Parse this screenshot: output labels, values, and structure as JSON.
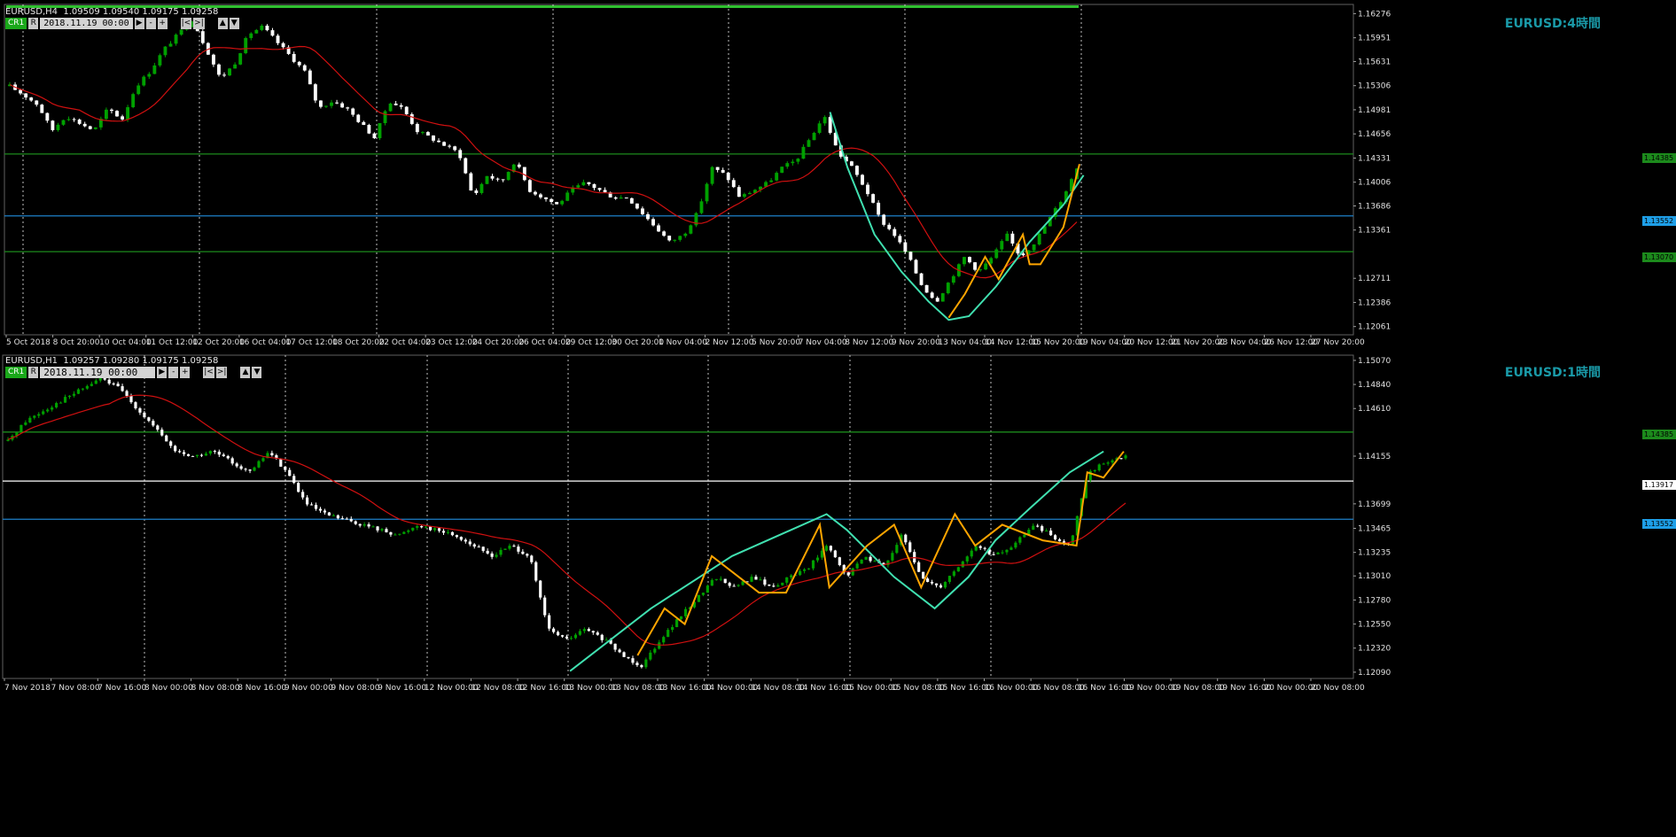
{
  "theme": {
    "bull_color": "#00a000",
    "bear_color": "#ffffff",
    "ma_color": "#d01010",
    "grid_color": "#808080",
    "hline_blue": "#1e7fc8",
    "hline_green": "#1c8a1c",
    "hline_white": "#ffffff",
    "wave_teal": "#40e0b0",
    "wave_orange": "#ffa500",
    "label_color": "#1a9aa8"
  },
  "top_chart": {
    "header": "EURUSD,H4  1.09509 1.09540 1.09175 1.09258",
    "controls": {
      "cr": "CR1",
      "r": "R",
      "date": "2018.11.19 00:00",
      "btn_play": "▶",
      "btn_minus": "-",
      "btn_plus": "+",
      "btn_first": "|<",
      "btn_last": ">|",
      "btn_up": "▲",
      "btn_down": "▼"
    },
    "watermark": "EURUSD:4時間",
    "price_labels": [
      "1.16276",
      "1.15951",
      "1.15631",
      "1.15306",
      "1.14981",
      "1.14656",
      "1.14331",
      "1.14006",
      "1.13686",
      "1.13361",
      "1.12711",
      "1.12386",
      "1.12061"
    ],
    "tags": {
      "green_high": "1.14385",
      "blue": "1.13552",
      "green_low": "1.13070"
    },
    "time_labels": [
      "5 Oct 2018",
      "8 Oct 20:00",
      "10 Oct 04:00",
      "11 Oct 12:00",
      "12 Oct 20:00",
      "16 Oct 04:00",
      "17 Oct 12:00",
      "18 Oct 20:00",
      "22 Oct 04:00",
      "23 Oct 12:00",
      "24 Oct 20:00",
      "26 Oct 04:00",
      "29 Oct 12:00",
      "30 Oct 20:00",
      "1 Nov 04:00",
      "2 Nov 12:00",
      "5 Nov 20:00",
      "7 Nov 04:00",
      "8 Nov 12:00",
      "9 Nov 20:00",
      "13 Nov 04:00",
      "14 Nov 12:00",
      "15 Nov 20:00",
      "19 Nov 04:00",
      "20 Nov 12:00",
      "21 Nov 20:00",
      "23 Nov 04:00",
      "26 Nov 12:00",
      "27 Nov 20:00"
    ]
  },
  "bottom_chart": {
    "header": "EURUSD,H1  1.09257 1.09280 1.09175 1.09258",
    "controls": {
      "cr": "CR1",
      "r": "R",
      "date": "2018.11.19 00:00",
      "btn_play": "▶",
      "btn_minus": "-",
      "btn_plus": "+",
      "btn_first": "|<",
      "btn_last": ">|",
      "btn_up": "▲",
      "btn_down": "▼"
    },
    "watermark": "EURUSD:1時間",
    "price_labels": [
      "1.15070",
      "1.14840",
      "1.14610",
      "1.14155",
      "1.13699",
      "1.13465",
      "1.13235",
      "1.13010",
      "1.12780",
      "1.12550",
      "1.12320",
      "1.12090"
    ],
    "tags": {
      "green_high": "1.14385",
      "white": "1.13917",
      "blue": "1.13552"
    },
    "time_labels": [
      "7 Nov 2018",
      "7 Nov 08:00",
      "7 Nov 16:00",
      "8 Nov 00:00",
      "8 Nov 08:00",
      "8 Nov 16:00",
      "9 Nov 00:00",
      "9 Nov 08:00",
      "9 Nov 16:00",
      "12 Nov 00:00",
      "12 Nov 08:00",
      "12 Nov 16:00",
      "13 Nov 00:00",
      "13 Nov 08:00",
      "13 Nov 16:00",
      "14 Nov 00:00",
      "14 Nov 08:00",
      "14 Nov 16:00",
      "15 Nov 00:00",
      "15 Nov 08:00",
      "15 Nov 16:00",
      "16 Nov 00:00",
      "16 Nov 08:00",
      "16 Nov 16:00",
      "19 Nov 00:00",
      "19 Nov 08:00",
      "19 Nov 16:00",
      "20 Nov 00:00",
      "20 Nov 08:00"
    ]
  },
  "chart_data": [
    {
      "type": "candlestick",
      "title": "EURUSD,H4",
      "ylim": [
        1.1195,
        1.164
      ],
      "horizontal_lines": [
        1.14385,
        1.13552,
        1.1307
      ],
      "close_path": [
        1.153,
        1.1518,
        1.1505,
        1.147,
        1.149,
        1.148,
        1.147,
        1.15,
        1.1485,
        1.153,
        1.155,
        1.158,
        1.16,
        1.162,
        1.158,
        1.154,
        1.156,
        1.16,
        1.161,
        1.159,
        1.157,
        1.155,
        1.15,
        1.151,
        1.15,
        1.148,
        1.146,
        1.151,
        1.15,
        1.147,
        1.146,
        1.145,
        1.144,
        1.138,
        1.141,
        1.14,
        1.143,
        1.139,
        1.138,
        1.137,
        1.139,
        1.14,
        1.139,
        1.138,
        1.138,
        1.136,
        1.134,
        1.132,
        1.133,
        1.136,
        1.142,
        1.141,
        1.138,
        1.139,
        1.14,
        1.142,
        1.143,
        1.146,
        1.149,
        1.144,
        1.142,
        1.139,
        1.135,
        1.133,
        1.13,
        1.126,
        1.124,
        1.127,
        1.13,
        1.128,
        1.13,
        1.133,
        1.13,
        1.132,
        1.135,
        1.138,
        1.142
      ]
    },
    {
      "type": "candlestick",
      "title": "EURUSD,H1",
      "ylim": [
        1.1203,
        1.1512
      ],
      "horizontal_lines": [
        1.14385,
        1.13917,
        1.13552
      ],
      "close_path": [
        1.143,
        1.145,
        1.146,
        1.147,
        1.148,
        1.149,
        1.148,
        1.146,
        1.144,
        1.142,
        1.1415,
        1.142,
        1.141,
        1.14,
        1.142,
        1.14,
        1.137,
        1.136,
        1.1355,
        1.135,
        1.1345,
        1.134,
        1.135,
        1.1345,
        1.134,
        1.133,
        1.132,
        1.133,
        1.132,
        1.125,
        1.124,
        1.125,
        1.124,
        1.1225,
        1.1215,
        1.124,
        1.126,
        1.128,
        1.13,
        1.129,
        1.13,
        1.129,
        1.13,
        1.131,
        1.133,
        1.13,
        1.132,
        1.131,
        1.134,
        1.13,
        1.129,
        1.131,
        1.133,
        1.132,
        1.133,
        1.135,
        1.134,
        1.133,
        1.14,
        1.141,
        1.1415
      ]
    }
  ]
}
